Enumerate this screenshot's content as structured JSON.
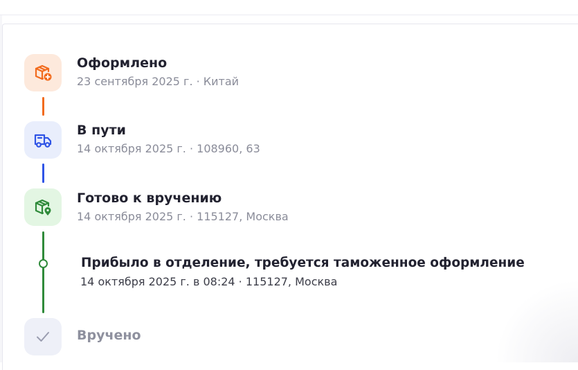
{
  "steps": [
    {
      "title": "Оформлено",
      "subtitle": "23 сентября 2025 г. · Китай",
      "icon": "box-plus-icon",
      "color": "#f26b1d",
      "bg": "#fde9dc"
    },
    {
      "title": "В пути",
      "subtitle": "14 октября 2025 г. · 108960, 63",
      "icon": "truck-icon",
      "color": "#2f54e6",
      "bg": "#e9eefc"
    },
    {
      "title": "Готово к вручению",
      "subtitle": "14 октября 2025 г. · 115127, Москва",
      "icon": "box-location-icon",
      "color": "#2f8a3a",
      "bg": "#e3f6e3"
    },
    {
      "title": "Вручено",
      "icon": "check-icon",
      "color": "#9a9db0",
      "bg": "#eef0f8"
    }
  ],
  "event": {
    "title": "Прибыло в отделение, требуется таможенное оформление",
    "subtitle": "14 октября 2025 г. в 08:24 · 115127, Москва"
  }
}
